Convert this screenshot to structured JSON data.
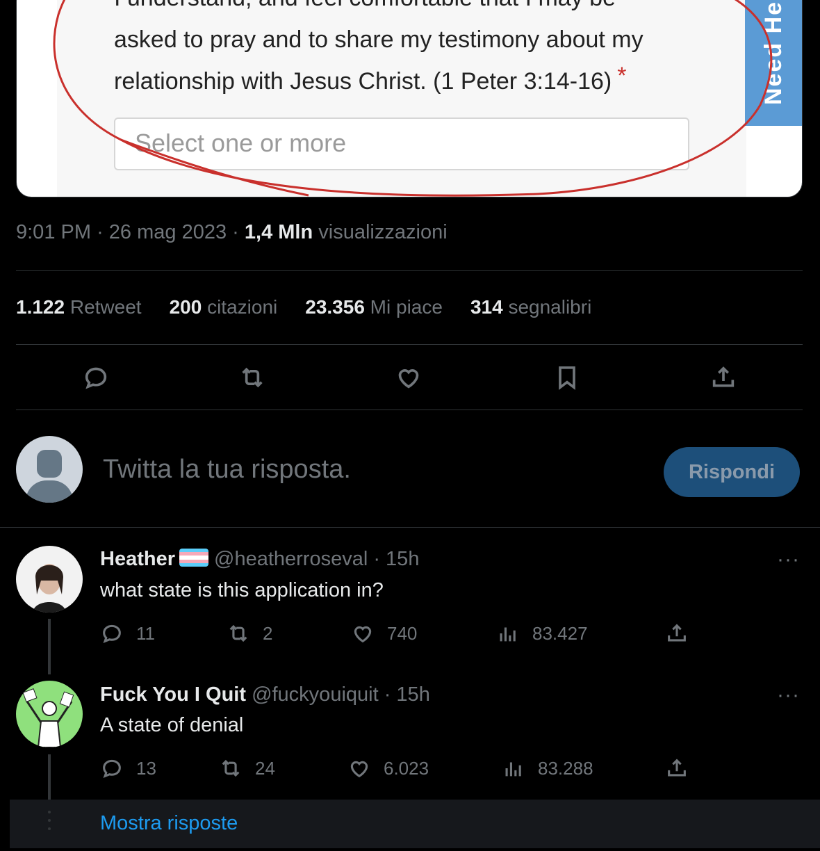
{
  "embedded_image": {
    "form_lines": [
      "I understand, and feel comfortable that I may be",
      "asked to pray and to share my testimony about my",
      "relationship with Jesus Christ. (1 Peter 3:14-16)"
    ],
    "required_mark": "*",
    "select_placeholder": "Select one or more",
    "side_tab": "Need He"
  },
  "tweet_meta": {
    "time": "9:01 PM",
    "date": "26 mag 2023",
    "views_value": "1,4 Mln",
    "views_label": "visualizzazioni",
    "separator": "·"
  },
  "stats": {
    "retweets_value": "1.122",
    "retweets_label": "Retweet",
    "quotes_value": "200",
    "quotes_label": "citazioni",
    "likes_value": "23.356",
    "likes_label": "Mi piace",
    "bookmarks_value": "314",
    "bookmarks_label": "segnalibri"
  },
  "actions": [
    "reply-icon",
    "retweet-icon",
    "like-icon",
    "bookmark-icon",
    "share-icon"
  ],
  "composer": {
    "placeholder": "Twitta la tua risposta.",
    "button_label": "Rispondi"
  },
  "replies": [
    {
      "name": "Heather",
      "handle": "@heatherroseval",
      "time": "· 15h",
      "text": "what state is this application in?",
      "replies": "11",
      "retweets": "2",
      "likes": "740",
      "views": "83.427",
      "more": "···",
      "flag_colors": [
        "#5bcefa",
        "#f5a9b8",
        "#ffffff",
        "#f5a9b8",
        "#5bcefa"
      ]
    },
    {
      "name": "Fuck You I Quit",
      "handle": "@fuckyouiquit",
      "time": "· 15h",
      "text": "A state of denial",
      "replies": "13",
      "retweets": "24",
      "likes": "6.023",
      "views": "83.288",
      "more": "···"
    }
  ],
  "show_replies_label": "Mostra risposte",
  "colors": {
    "accent": "#1d9bf0",
    "muted": "#71767b",
    "background": "#000000",
    "annotation_red": "#c9302c"
  }
}
